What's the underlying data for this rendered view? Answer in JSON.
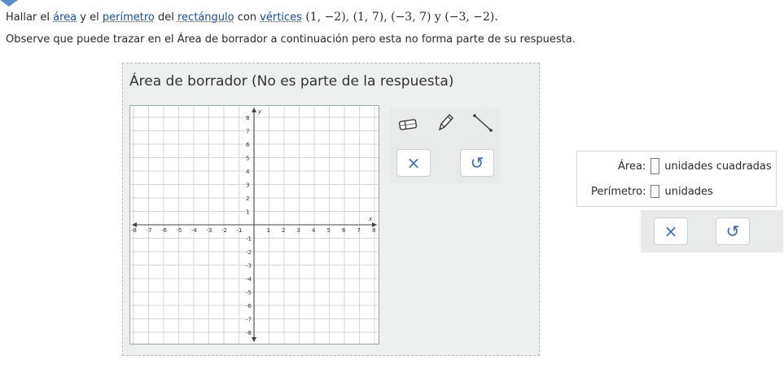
{
  "prompt": {
    "p1": "Hallar el ",
    "area_link": "área",
    "p2": " y el ",
    "perim_link": "perímetro",
    "p3": " del ",
    "rect_link": "rectángulo",
    "p4": " con ",
    "vert_link": "vértices",
    "vertices_math": " (1, −2), (1, 7), (−3, 7) y (−3, −2)."
  },
  "observe_text": "Observe que puede trazar en el Área de borrador a continuación pero esta no forma parte de su respuesta.",
  "scratch": {
    "title": "Área de borrador (No es parte de la respuesta)",
    "x_axis_label": "x",
    "y_axis_label": "y",
    "x_ticks": [
      "-8",
      "-7",
      "-6",
      "-5",
      "-4",
      "-3",
      "-2",
      "-1",
      "1",
      "2",
      "3",
      "4",
      "5",
      "6",
      "7",
      "8"
    ],
    "y_ticks": [
      "8",
      "7",
      "6",
      "5",
      "4",
      "3",
      "2",
      "1",
      "-1",
      "-2",
      "-3",
      "-4",
      "-5",
      "-6",
      "-7",
      "-8"
    ],
    "tools": [
      "eraser-icon",
      "pencil-icon",
      "line-segment-icon"
    ],
    "clear_symbol": "×",
    "undo_symbol": "↺"
  },
  "answer": {
    "area_label": "Área:",
    "area_units": "unidades cuadradas",
    "area_value": "",
    "perim_label": "Perímetro:",
    "perim_units": "unidades",
    "perim_value": "",
    "clear_symbol": "×",
    "undo_symbol": "↺"
  },
  "colors": {
    "accent": "#3a6aa9",
    "scratch_bg": "#eef0f0",
    "grid": "#c8cccc"
  }
}
